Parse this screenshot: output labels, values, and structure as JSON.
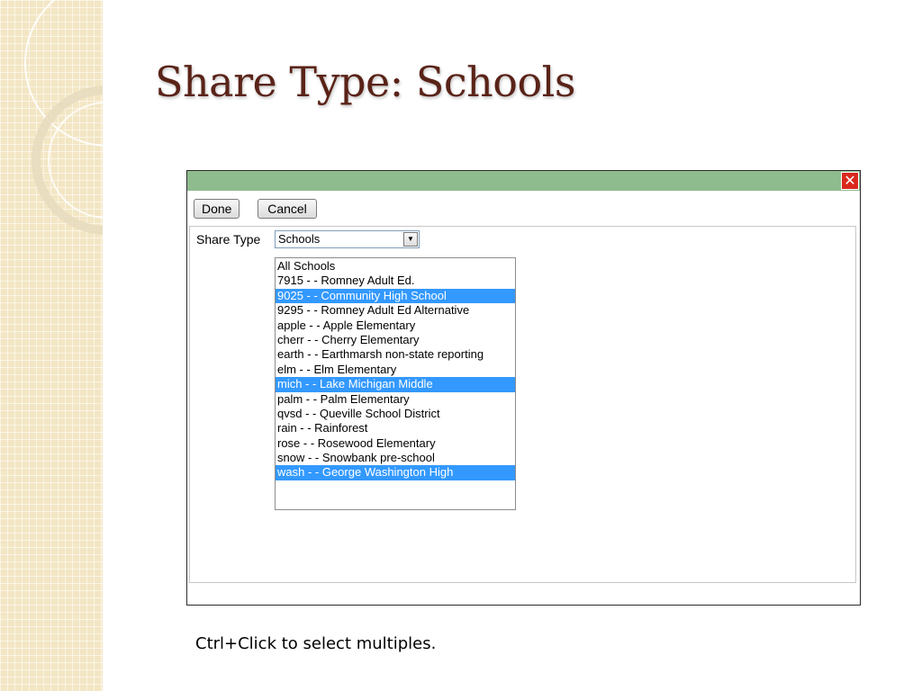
{
  "slide": {
    "title": "Share Type: Schools",
    "caption": "Ctrl+Click to select multiples."
  },
  "dialog": {
    "close_icon": "close-icon",
    "close_glyph": "✕",
    "done_label": "Done",
    "cancel_label": "Cancel",
    "share_type_label": "Share Type",
    "share_type_value": "Schools",
    "dropdown_glyph": "▼",
    "schools": [
      {
        "label": "All Schools",
        "selected": false
      },
      {
        "label": "7915 - - Romney Adult Ed.",
        "selected": false
      },
      {
        "label": "9025 - - Community High School",
        "selected": true
      },
      {
        "label": "9295 - - Romney Adult Ed Alternative",
        "selected": false
      },
      {
        "label": "apple - - Apple Elementary",
        "selected": false
      },
      {
        "label": "cherr - - Cherry Elementary",
        "selected": false
      },
      {
        "label": "earth - - Earthmarsh non-state reporting",
        "selected": false
      },
      {
        "label": "elm - - Elm Elementary",
        "selected": false
      },
      {
        "label": "mich - - Lake Michigan Middle",
        "selected": true
      },
      {
        "label": "palm - - Palm Elementary",
        "selected": false
      },
      {
        "label": "qvsd - - Queville School District",
        "selected": false
      },
      {
        "label": "rain - - Rainforest",
        "selected": false
      },
      {
        "label": "rose - - Rosewood Elementary",
        "selected": false
      },
      {
        "label": "snow - - Snowbank pre-school",
        "selected": false
      },
      {
        "label": "wash - - George Washington High",
        "selected": true
      }
    ]
  },
  "colors": {
    "title": "#5a2318",
    "titlebar": "#8fbc8f",
    "selection": "#3399ff",
    "close": "#d9281e"
  }
}
